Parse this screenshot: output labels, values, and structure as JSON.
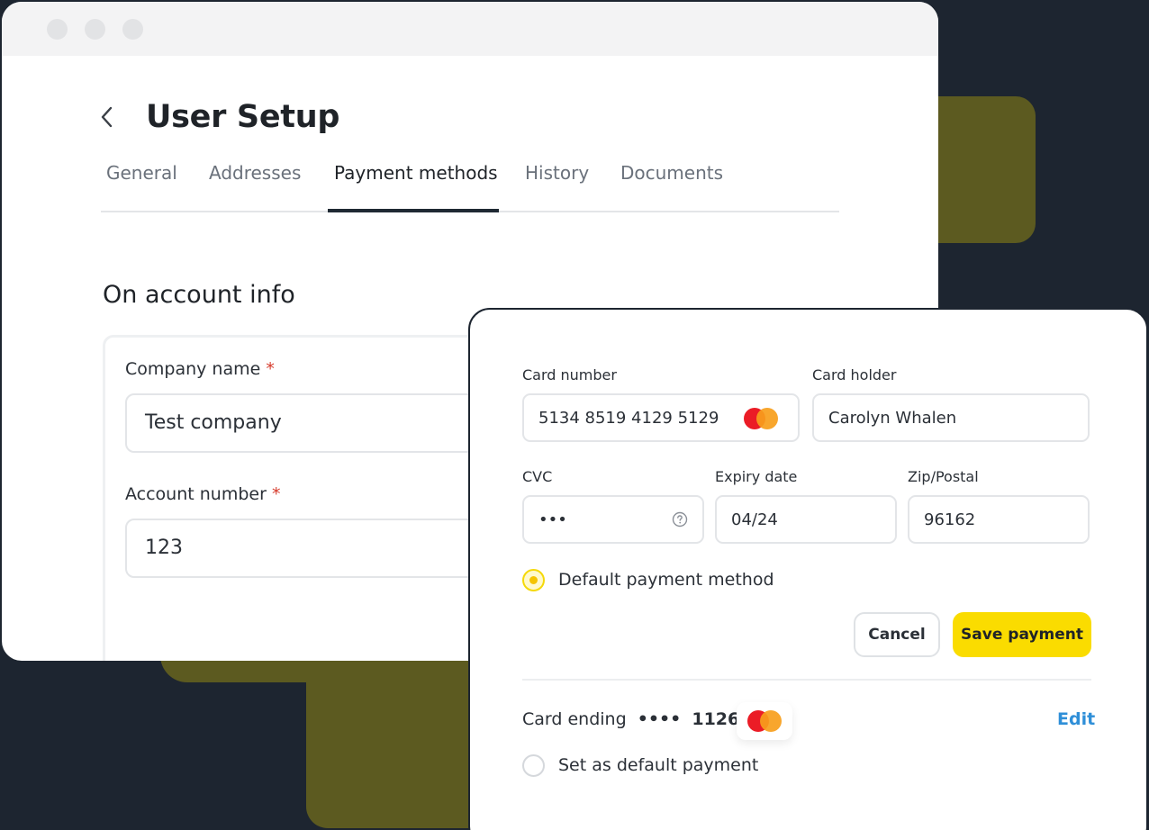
{
  "window": {
    "title": "User Setup",
    "tabs": [
      {
        "label": "General",
        "active": false
      },
      {
        "label": "Addresses",
        "active": false
      },
      {
        "label": "Payment methods",
        "active": true
      },
      {
        "label": "History",
        "active": false
      },
      {
        "label": "Documents",
        "active": false
      }
    ],
    "section_title": "On account info",
    "company_name": {
      "label": "Company name",
      "required_mark": "*",
      "value": "Test company"
    },
    "account_number": {
      "label": "Account number",
      "required_mark": "*",
      "value": "123"
    }
  },
  "payment": {
    "card_number": {
      "label": "Card number",
      "value": "5134 8519 4129 5129"
    },
    "card_holder": {
      "label": "Card holder",
      "value": "Carolyn Whalen"
    },
    "cvc": {
      "label": "CVC",
      "value": "•••"
    },
    "expiry": {
      "label": "Expiry date",
      "value": "04/24"
    },
    "zip": {
      "label": "Zip/Postal",
      "value": "96162"
    },
    "default_option": {
      "label": "Default payment method",
      "selected": true
    },
    "cancel_label": "Cancel",
    "save_label": "Save payment",
    "saved_card": {
      "prefix": "Card ending",
      "mask": "••••",
      "last4": "1126",
      "edit_label": "Edit",
      "default_label": "Set as default payment",
      "default_selected": false
    }
  },
  "icons": {
    "back": "chevron-left-icon",
    "card_brand": "mastercard-icon",
    "help": "question-circle-icon"
  },
  "colors": {
    "accent": "#fadc00",
    "link": "#2f8fd8",
    "required": "#d63a2b",
    "background": "#1d2530"
  }
}
